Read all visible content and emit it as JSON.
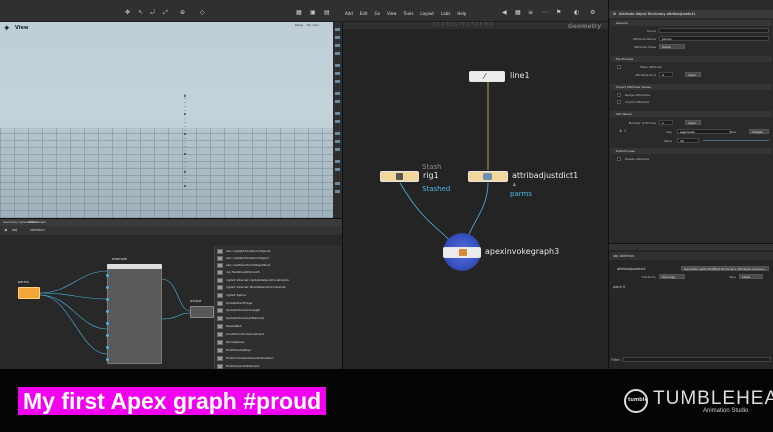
{
  "menu": [
    "Add",
    "Edit",
    "Go",
    "View",
    "Tools",
    "Layout",
    "Labs",
    "Help"
  ],
  "viewport": {
    "label": "View",
    "dropdown_left": "Persp",
    "dropdown_right": "No cam"
  },
  "network_left": {
    "tabs": [
      "Geometry Spreadsheet",
      "APEX Graph"
    ],
    "path_root": "obj",
    "path_node": "skeleton",
    "nodes": {
      "parms": "parms",
      "example": "example",
      "output": "output"
    },
    "tab_menu_items": [
      "abc::UpdateTransformObjects",
      "abc::UpdateTransformObject",
      "abc::GetTransformObjectRoot",
      "rig::TwoBoneIKSmooth",
      "rigdef::internal::UpdateSetendConstraints",
      "rigdef::internal::BuildSetendConstraints",
      "rigdef::Spline",
      "UpdatePointFlags",
      "UpdateCharacterLegIK",
      "UpdateCharacterElement",
      "DeleteBeh",
      "LocalTransformConstraint",
      "ParmsSpace",
      "FindPickableExpr",
      "FindOrCreateCharacterSkeleton",
      "FindCharacterElement"
    ]
  },
  "network_center": {
    "context_label": "Geometry",
    "watermark": "STRESSTESTDEMO",
    "nodes": {
      "line1": "line1",
      "rig1": "rig1",
      "rig1_flag": "Stash",
      "rig1_sub": "Stashed",
      "attribadjust": "attribadjustdict1",
      "attribadjust_sub": "parms",
      "apex": "apexinvokegraph3"
    }
  },
  "parm_pane": {
    "title": "Attribute Adjust Dictionary  attribadjustdict1",
    "sections": {
      "general": "General",
      "preprocess": "Pre-Process",
      "import": "Import Attribute Values",
      "set_values": "Set Values",
      "postprocess": "Post-Process"
    },
    "group_label": "Group",
    "attr_name_label": "Attribute Name",
    "attr_name_value": "parms",
    "attr_class_label": "Attribute Class",
    "attr_class_value": "Detail",
    "mask_attr_label": "Mask Attribute",
    "mask_kind_label": "Attribute Kind",
    "mask_value": "0",
    "clear_label": "Clear",
    "range_label": "Range Attributes",
    "import_attr_label": "Import Attribute",
    "num_entries_label": "Number of Entries",
    "num_entries_value": "1",
    "key_label": "Key",
    "key_value": "segments",
    "type_label": "Type",
    "type_value": "Integer",
    "value_label": "Value",
    "value_value": "10",
    "output_label": "Delete Attribute"
  },
  "sheet_pane": {
    "path": "obj  skeleton",
    "node_name": "attribadjustdict1",
    "desc": "Geometry with Modified Dictionary Attribute (subgeo)",
    "hierarchy_label": "Hierarchy",
    "hierarchy_value": "Topology",
    "type_label": "Type",
    "type_value": "Label",
    "row": "point 0",
    "filter_label": "Filter:"
  },
  "caption": "My first Apex graph  #proud",
  "brand": {
    "logo_text": "tumble",
    "name": "TUMBLEHEAD",
    "sub": "Animation Studio"
  },
  "colors": {
    "caption_bg": "#f100f0",
    "node_orange": "#f2a63a",
    "node_yellow": "#f2d79a",
    "wire_blue": "#4ab5e6",
    "wire_yellow": "#e0c25a"
  }
}
